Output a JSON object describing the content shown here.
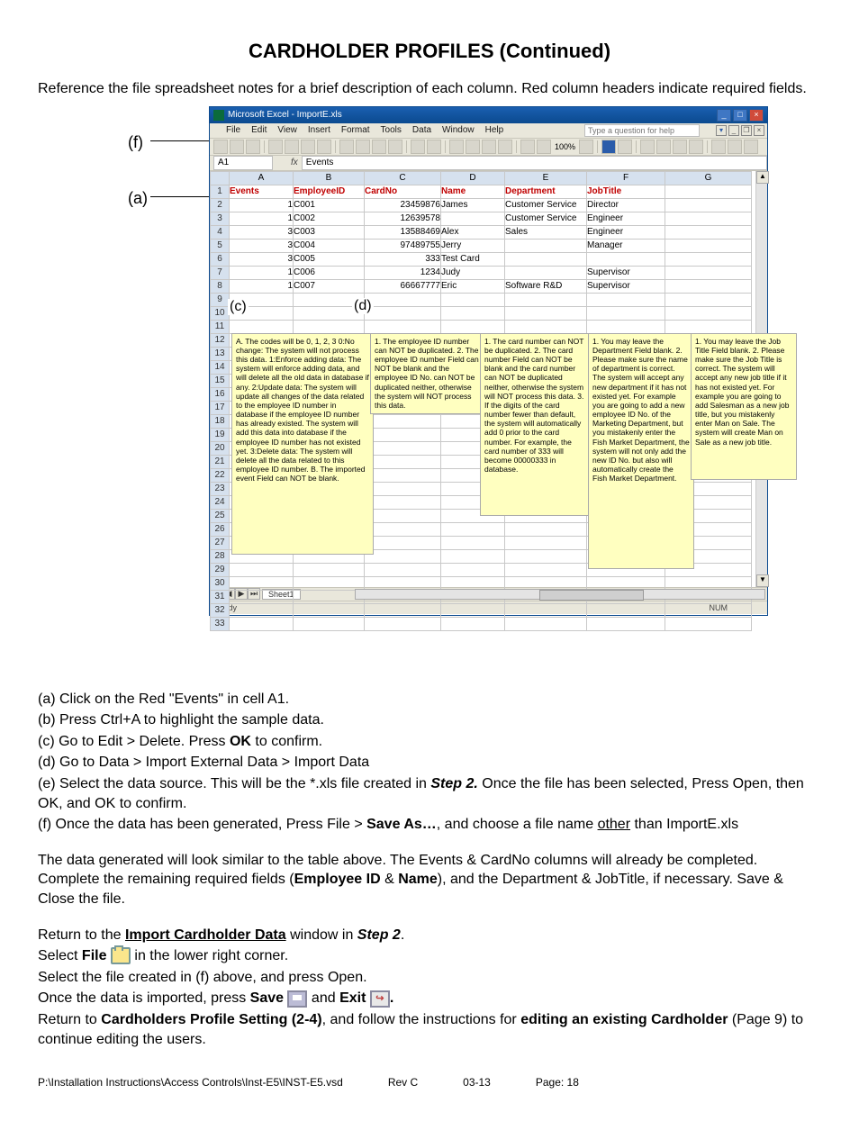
{
  "title": "CARDHOLDER PROFILES (Continued)",
  "intro": "Reference the file spreadsheet notes for a brief description of each column. Red column headers indicate required fields.",
  "labels": {
    "f": "(f)",
    "a": "(a)",
    "c": "(c)",
    "d": "(d)"
  },
  "excel": {
    "title": "Microsoft Excel - ImportE.xls",
    "help_placeholder": "Type a question for help",
    "menu": [
      "File",
      "Edit",
      "View",
      "Insert",
      "Format",
      "Tools",
      "Data",
      "Window",
      "Help"
    ],
    "zoom": "100%",
    "namebox": "A1",
    "fx_label": "fx",
    "fx_value": "Events",
    "cols": [
      "",
      "A",
      "B",
      "C",
      "D",
      "E",
      "F",
      "G"
    ],
    "headers": [
      "Events",
      "EmployeeID",
      "CardNo",
      "Name",
      "Department",
      "JobTitle",
      ""
    ],
    "rows": [
      [
        "2",
        "1",
        "C001",
        "23459876",
        "James",
        "Customer Service",
        "Director",
        ""
      ],
      [
        "3",
        "1",
        "C002",
        "12639578",
        "",
        "Customer Service",
        "Engineer",
        ""
      ],
      [
        "4",
        "3",
        "C003",
        "13588469",
        "Alex",
        "Sales",
        "Engineer",
        ""
      ],
      [
        "5",
        "3",
        "C004",
        "97489755",
        "Jerry",
        "",
        "Manager",
        ""
      ],
      [
        "6",
        "3",
        "C005",
        "333",
        "Test Card",
        "",
        "",
        ""
      ],
      [
        "7",
        "1",
        "C006",
        "1234",
        "Judy",
        "",
        "Supervisor",
        ""
      ],
      [
        "8",
        "1",
        "C007",
        "66667777",
        "Eric",
        "Software R&D",
        "Supervisor",
        ""
      ]
    ],
    "empty_rows": [
      "9",
      "10",
      "11",
      "12",
      "13",
      "14",
      "15",
      "16",
      "17",
      "18",
      "19",
      "20",
      "21",
      "22",
      "23",
      "24",
      "25",
      "26",
      "27",
      "28",
      "29",
      "30",
      "31",
      "32",
      "33"
    ],
    "callouts": {
      "c1": "A. The codes will be 0, 1, 2, 3\n  0:No change: The system will not process this data.\n  1:Enforce adding data: The system will enforce adding data, and will delete all the old data in database if any.\n  2:Update data: The system will update all changes of the data related to the employee ID number in database if the employee ID number has already existed. The system will add this data into database if the employee ID number has not existed yet.\n  3:Delete data: The system will delete all the data related to this employee ID number.\n\nB. The imported event Field can NOT be blank.",
      "c2": "1. The employee ID number can NOT be duplicated.\n2. The employee ID number Field can NOT be blank and the employee ID No. can NOT be duplicated neither, otherwise the system will NOT process this data.",
      "c3": "1. The card number can NOT be duplicated.\n2. The card number Field can NOT be blank and the card number can NOT be duplicated neither, otherwise the system will NOT process this data.\n3. If the digits of the card number fewer than default, the system will automatically add 0 prior to the card number. For example, the card number of 333 will become 00000333 in database.",
      "c4": "1. You may leave the Department Field blank.\n2. Please make sure the name of department is correct. The system will accept any new department if it has not existed yet. For example you are going to add a new employee ID No. of the Marketing Department, but you mistakenly enter the Fish Market Department, the system will not only add the new ID No. but also will automatically create the Fish Market Department.",
      "c5": "1. You may leave the Job Title Field blank.\n2. Please make sure the Job Title is correct. The system will accept any new job title if it has not existed yet. For example you are going to add Salesman as a new job title, but you mistakenly enter Man on Sale. The system will create Man on Sale as a new job title."
    },
    "sheet_tab": "Sheet1",
    "status_ready": "Ready",
    "status_num": "NUM"
  },
  "steps": {
    "a": "(a) Click on the Red \"Events\" in cell A1.",
    "b": "(b) Press Ctrl+A to highlight the sample data.",
    "c_pre": "(c) Go to Edit > Delete.  Press ",
    "c_bold": "OK",
    "c_post": " to confirm.",
    "d": "(d) Go to Data > Import External Data > Import Data",
    "e_pre": "(e) Select the data source.  This will be the *.xls file created in ",
    "e_step": "Step 2.",
    "e_post": "  Once the file has been selected, Press Open, then OK, and OK to confirm.",
    "f_pre": "(f) Once the data has been generated, Press File > ",
    "f_bold": "Save As…",
    "f_mid": ", and choose a file name ",
    "f_u": "other",
    "f_post": " than ImportE.xls"
  },
  "para2_pre": "The data generated will look similar to the table above.  The Events & CardNo columns will already be completed.  Complete the remaining required fields (",
  "para2_b1": "Employee ID",
  "para2_amp": " & ",
  "para2_b2": "Name",
  "para2_post": "), and the Department & JobTitle, if necessary.  Save & Close the file.",
  "para3": {
    "l1_pre": "Return to the ",
    "l1_b": "Import Cardholder Data",
    "l1_mid": " window in ",
    "l1_step": "Step 2",
    "l1_post": ".",
    "l2_pre": "Select ",
    "l2_b": "File",
    "l2_post": " in the lower right corner.",
    "l3": "Select the file created in (f) above, and press Open.",
    "l4_pre": "Once the data is imported, press ",
    "l4_b1": "Save ",
    "l4_mid": " and ",
    "l4_b2": "Exit ",
    "l4_post": ".",
    "l5_pre": "Return to ",
    "l5_b1": "Cardholders Profile Setting (2-4)",
    "l5_mid": ", and follow the instructions for ",
    "l5_b2": "editing an existing Cardholder",
    "l5_post": " (Page 9) to continue editing the users."
  },
  "footer": {
    "path": "P:\\Installation Instructions\\Access Controls\\Inst-E5\\INST-E5.vsd",
    "rev": "Rev C",
    "date": "03-13",
    "page": "Page: 18"
  }
}
